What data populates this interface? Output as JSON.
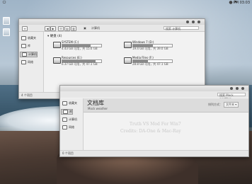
{
  "desktop": {
    "clock": "PM 03:03",
    "topbar_icons": [
      "power-icon",
      "user-icon",
      "flag-icon"
    ]
  },
  "explorer": {
    "address": "计算机",
    "search_placeholder": "搜索 计算机",
    "nav": {
      "back": "◀",
      "forward": "▶"
    },
    "sidebar": [
      {
        "label": "收藏夹",
        "icon": "star-icon"
      },
      {
        "label": "库",
        "icon": "library-icon"
      },
      {
        "label": "计算机",
        "icon": "computer-icon",
        "active": true
      },
      {
        "label": "网络",
        "icon": "network-icon"
      }
    ],
    "group_label": "▾ 硬盘 (4)",
    "drives": [
      {
        "name": "SYSTEM (C:)",
        "size": "4.43 GB 可用，共 15.6 GB",
        "used": 0.72
      },
      {
        "name": "Windows 7 (D:)",
        "size": "19.4 GB 可用，共 39.0 GB",
        "used": 0.5
      },
      {
        "name": "Resources (E:)",
        "size": "6.37 GB 可用，共 47.1 GB",
        "used": 0.86
      },
      {
        "name": "Media Files (F:)",
        "size": "28.8 GB 可用，共 47.1 GB",
        "used": 0.39
      }
    ],
    "status": "4 个项目"
  },
  "library": {
    "search_placeholder": "搜索 Mock weather",
    "title": "文档库",
    "subtitle": "Mock weather",
    "arrange_label": "排列方式：",
    "arrange_value": "文件夹 ▾",
    "sidebar": [
      {
        "label": "收藏夹",
        "icon": "star-icon"
      },
      {
        "label": "库",
        "icon": "library-icon",
        "active": true
      },
      {
        "label": "计算机",
        "icon": "computer-icon"
      },
      {
        "label": "网络",
        "icon": "network-icon"
      }
    ],
    "status": "0 个项目"
  },
  "credits": {
    "line1": "Truth VS Mod For Win7",
    "line2": "Credits: DA-One & Mac-Ray"
  }
}
